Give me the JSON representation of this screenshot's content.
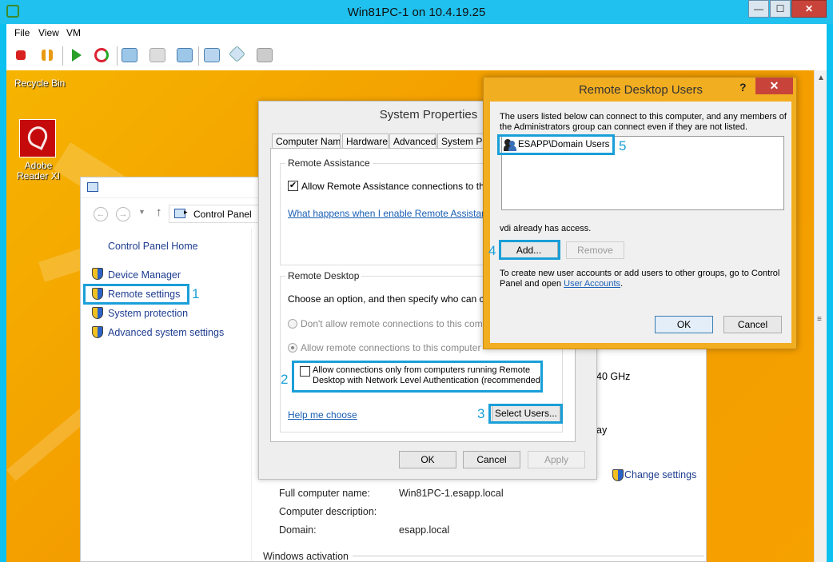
{
  "vm": {
    "title": "Win81PC-1 on 10.4.19.25",
    "menu": [
      "File",
      "View",
      "VM"
    ],
    "window_controls": {
      "minimize": "—",
      "maximize": "☐",
      "close": "✕"
    }
  },
  "desktop": {
    "icons": [
      {
        "label": "Recycle Bin"
      },
      {
        "label": "Adobe Reader XI"
      }
    ]
  },
  "control_panel": {
    "address": "Control Panel",
    "home_link": "Control Panel Home",
    "links": [
      "Device Manager",
      "Remote settings",
      "System protection",
      "Advanced system settings"
    ],
    "step_label": "1",
    "change_settings": "Change settings",
    "partial_text": {
      "ghz": "40 GHz",
      "ay": "ay"
    },
    "info": [
      {
        "label": "Full computer name:",
        "value": "Win81PC-1.esapp.local"
      },
      {
        "label": "Computer description:",
        "value": ""
      },
      {
        "label": "Domain:",
        "value": "esapp.local"
      }
    ],
    "windows_activation": "Windows activation"
  },
  "system_properties": {
    "title": "System Properties",
    "tabs": [
      "Computer Name",
      "Hardware",
      "Advanced",
      "System Prot"
    ],
    "remote_assistance": {
      "group_label": "Remote Assistance",
      "allow_checkbox": "Allow Remote Assistance connections to this com",
      "link": "What happens when I enable Remote Assistance?"
    },
    "remote_desktop": {
      "group_label": "Remote Desktop",
      "choose_text": "Choose an option, and then specify who can connec",
      "radio_dont_allow": "Don't allow remote connections to this computer",
      "radio_allow": "Allow remote connections to this computer",
      "nla_line1": "Allow connections only from computers running Remote",
      "nla_line2": "Desktop with Network Level Authentication (recommended)",
      "help_link": "Help me choose",
      "select_users_button": "Select Users...",
      "step2_label": "2",
      "step3_label": "3"
    },
    "buttons": {
      "ok": "OK",
      "cancel": "Cancel",
      "apply": "Apply"
    }
  },
  "remote_desktop_users": {
    "title": "Remote Desktop Users",
    "help": "?",
    "close": "✕",
    "description_line1": "The users listed below can connect to this computer, and any members of",
    "description_line2": "the Administrators group can connect even if they are not listed.",
    "users": [
      "ESAPP\\Domain Users"
    ],
    "already_access": "vdi already has access.",
    "add_button": "Add...",
    "remove_button": "Remove",
    "step4_label": "4",
    "step5_label": "5",
    "footer_line1": "To create new user accounts or add users to other groups, go to Control",
    "footer_line2_prefix": "Panel and open ",
    "footer_link": "User Accounts",
    "footer_line2_suffix": ".",
    "ok": "OK",
    "cancel": "Cancel"
  },
  "colors": {
    "highlight": "#1a9fd8",
    "vm_titlebar": "#20c1ef",
    "desktop": "#f5a100",
    "dialog_frame": "#f2ae21"
  }
}
